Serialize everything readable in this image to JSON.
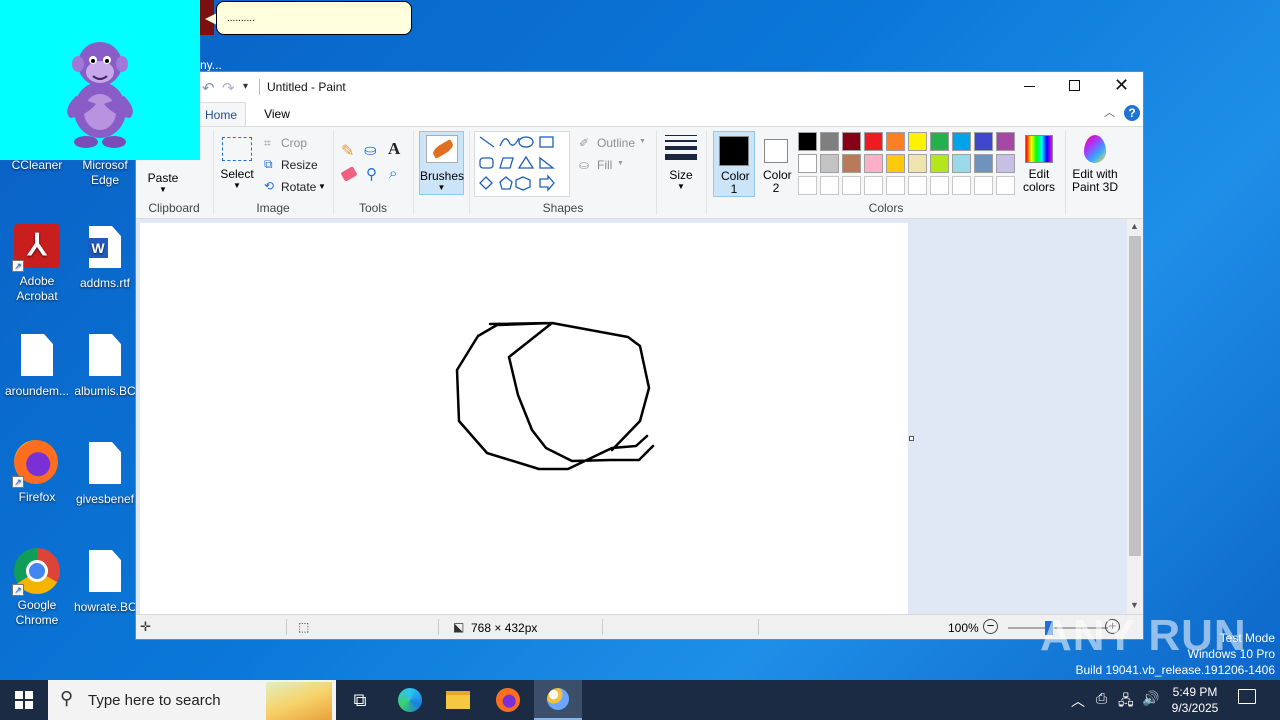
{
  "bonzi": {
    "bubble_text": "..........",
    "peek_text": "ny..."
  },
  "desktop_icons": [
    {
      "label": "CCleaner"
    },
    {
      "label": "Microsoft Edge"
    },
    {
      "label": "Adobe Acrobat"
    },
    {
      "label": "addms.rtf"
    },
    {
      "label": "aroundem..."
    },
    {
      "label": "albumis.BC"
    },
    {
      "label": "Firefox"
    },
    {
      "label": "givesbenef"
    },
    {
      "label": "Google Chrome"
    },
    {
      "label": "howrate.BC"
    }
  ],
  "paint": {
    "title": "Untitled - Paint",
    "tabs": [
      {
        "label": "Home"
      },
      {
        "label": "View"
      }
    ],
    "clipboard": {
      "paste": "Paste",
      "group": "Clipboard"
    },
    "image": {
      "select": "Select",
      "crop": "Crop",
      "resize": "Resize",
      "rotate": "Rotate",
      "group": "Image"
    },
    "tools": {
      "group": "Tools"
    },
    "brushes": "Brushes",
    "shapes": {
      "outline": "Outline",
      "fill": "Fill",
      "group": "Shapes"
    },
    "size": "Size",
    "colors": {
      "color1": "Color 1",
      "color2": "Color 2",
      "edit": "Edit colors",
      "group": "Colors",
      "color1_value": "#000000",
      "color2_value": "#ffffff",
      "row1": [
        "#000000",
        "#7f7f7f",
        "#880015",
        "#ed1c24",
        "#ff7f27",
        "#fff200",
        "#22b14c",
        "#00a2e8",
        "#3f48cc",
        "#a349a4"
      ],
      "row2": [
        "#ffffff",
        "#c3c3c3",
        "#b97a57",
        "#ffaec9",
        "#ffc90e",
        "#efe4b0",
        "#b5e61d",
        "#99d9ea",
        "#7092be",
        "#c8bfe7"
      ],
      "row3": [
        "#ffffff",
        "#ffffff",
        "#ffffff",
        "#ffffff",
        "#ffffff",
        "#ffffff",
        "#ffffff",
        "#ffffff",
        "#ffffff",
        "#ffffff"
      ]
    },
    "paint3d": "Edit with Paint 3D",
    "status": {
      "dimensions": "768 × 432px",
      "zoom": "100%"
    }
  },
  "taskbar": {
    "search_placeholder": "Type here to search",
    "time": "5:49 PM",
    "date": "9/3/2025"
  },
  "watermark": {
    "line1": "Test Mode",
    "line2": "Windows 10 Pro",
    "line3": "Build 19041.vb_release.191206-1406",
    "brand": "ANY RUN"
  }
}
